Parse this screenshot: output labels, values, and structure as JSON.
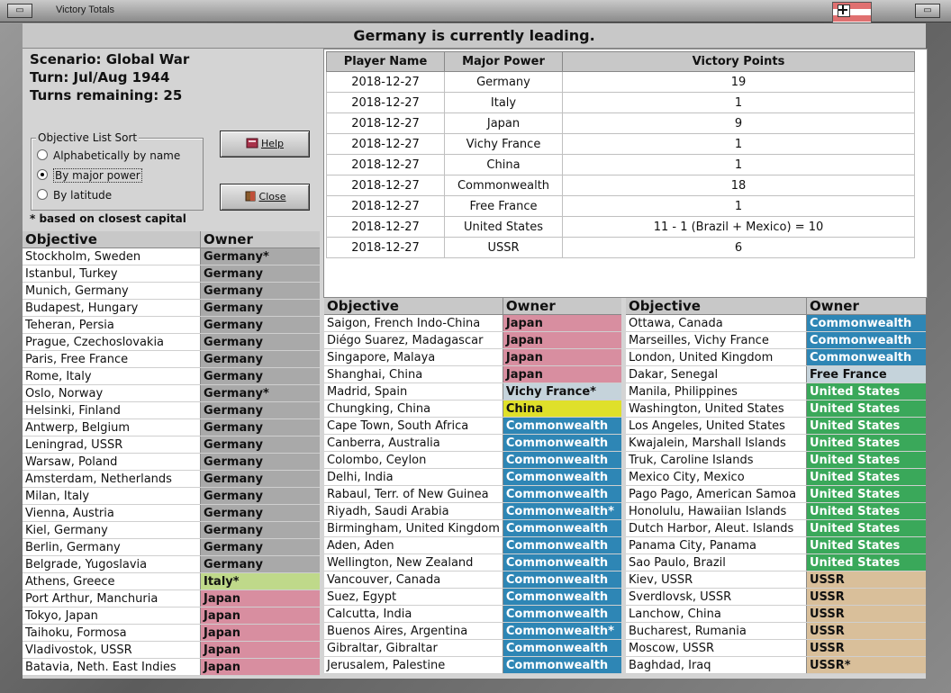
{
  "window": {
    "title": "Victory Totals",
    "menu_glyph": "▭",
    "close_glyph": "▭"
  },
  "banner": "Germany is currently leading.",
  "info": {
    "scenario": "Scenario: Global War",
    "turn": "Turn: Jul/Aug 1944",
    "turns_remaining": "Turns remaining: 25"
  },
  "sort": {
    "legend": "Objective List Sort",
    "options": [
      "Alphabetically by name",
      "By major power",
      "By latitude"
    ],
    "selected_index": 1
  },
  "note": "* based on closest capital",
  "buttons": {
    "help": "Help",
    "close": "Close"
  },
  "colors": {
    "germany": "#a9a9a9",
    "italy": "#bfd98a",
    "japan": "#d88ea0",
    "vichy": "#c5d3db",
    "china": "#dfe02a",
    "commonwealth": "#2e86b5",
    "free_france": "#c5d3db",
    "united_states": "#3aa85a",
    "ussr": "#d9bf9a"
  },
  "victory_table": {
    "headers": [
      "Player Name",
      "Major Power",
      "Victory Points"
    ],
    "rows": [
      [
        "2018-12-27",
        "Germany",
        "19"
      ],
      [
        "2018-12-27",
        "Italy",
        "1"
      ],
      [
        "2018-12-27",
        "Japan",
        "9"
      ],
      [
        "2018-12-27",
        "Vichy France",
        "1"
      ],
      [
        "2018-12-27",
        "China",
        "1"
      ],
      [
        "2018-12-27",
        "Commonwealth",
        "18"
      ],
      [
        "2018-12-27",
        "Free France",
        "1"
      ],
      [
        "2018-12-27",
        "United States",
        "11 - 1 (Brazil + Mexico) = 10"
      ],
      [
        "2018-12-27",
        "USSR",
        "6"
      ]
    ]
  },
  "objectives": {
    "headers": [
      "Objective",
      "Owner"
    ],
    "left": [
      [
        "Stockholm, Sweden",
        "Germany*",
        "germany"
      ],
      [
        "Istanbul, Turkey",
        "Germany",
        "germany"
      ],
      [
        "Munich, Germany",
        "Germany",
        "germany"
      ],
      [
        "Budapest, Hungary",
        "Germany",
        "germany"
      ],
      [
        "Teheran, Persia",
        "Germany",
        "germany"
      ],
      [
        "Prague, Czechoslovakia",
        "Germany",
        "germany"
      ],
      [
        "Paris, Free France",
        "Germany",
        "germany"
      ],
      [
        "Rome, Italy",
        "Germany",
        "germany"
      ],
      [
        "Oslo, Norway",
        "Germany*",
        "germany"
      ],
      [
        "Helsinki, Finland",
        "Germany",
        "germany"
      ],
      [
        "Antwerp, Belgium",
        "Germany",
        "germany"
      ],
      [
        "Leningrad, USSR",
        "Germany",
        "germany"
      ],
      [
        "Warsaw, Poland",
        "Germany",
        "germany"
      ],
      [
        "Amsterdam, Netherlands",
        "Germany",
        "germany"
      ],
      [
        "Milan, Italy",
        "Germany",
        "germany"
      ],
      [
        "Vienna, Austria",
        "Germany",
        "germany"
      ],
      [
        "Kiel, Germany",
        "Germany",
        "germany"
      ],
      [
        "Berlin, Germany",
        "Germany",
        "germany"
      ],
      [
        "Belgrade, Yugoslavia",
        "Germany",
        "germany"
      ],
      [
        "Athens, Greece",
        "Italy*",
        "italy"
      ],
      [
        "Port Arthur, Manchuria",
        "Japan",
        "japan"
      ],
      [
        "Tokyo, Japan",
        "Japan",
        "japan"
      ],
      [
        "Taihoku, Formosa",
        "Japan",
        "japan"
      ],
      [
        "Vladivostok, USSR",
        "Japan",
        "japan"
      ],
      [
        "Batavia, Neth. East Indies",
        "Japan",
        "japan"
      ]
    ],
    "middle": [
      [
        "Saigon, French Indo-China",
        "Japan",
        "japan"
      ],
      [
        "Diégo Suarez, Madagascar",
        "Japan",
        "japan"
      ],
      [
        "Singapore, Malaya",
        "Japan",
        "japan"
      ],
      [
        "Shanghai, China",
        "Japan",
        "japan"
      ],
      [
        "Madrid, Spain",
        "Vichy France*",
        "vichy"
      ],
      [
        "Chungking, China",
        "China",
        "china"
      ],
      [
        "Cape Town, South Africa",
        "Commonwealth",
        "commonwealth"
      ],
      [
        "Canberra, Australia",
        "Commonwealth",
        "commonwealth"
      ],
      [
        "Colombo, Ceylon",
        "Commonwealth",
        "commonwealth"
      ],
      [
        "Delhi, India",
        "Commonwealth",
        "commonwealth"
      ],
      [
        "Rabaul, Terr. of New Guinea",
        "Commonwealth",
        "commonwealth"
      ],
      [
        "Riyadh, Saudi Arabia",
        "Commonwealth*",
        "commonwealth"
      ],
      [
        "Birmingham, United Kingdom",
        "Commonwealth",
        "commonwealth"
      ],
      [
        "Aden, Aden",
        "Commonwealth",
        "commonwealth"
      ],
      [
        "Wellington, New Zealand",
        "Commonwealth",
        "commonwealth"
      ],
      [
        "Vancouver, Canada",
        "Commonwealth",
        "commonwealth"
      ],
      [
        "Suez, Egypt",
        "Commonwealth",
        "commonwealth"
      ],
      [
        "Calcutta, India",
        "Commonwealth",
        "commonwealth"
      ],
      [
        "Buenos Aires, Argentina",
        "Commonwealth*",
        "commonwealth"
      ],
      [
        "Gibraltar, Gibraltar",
        "Commonwealth",
        "commonwealth"
      ],
      [
        "Jerusalem, Palestine",
        "Commonwealth",
        "commonwealth"
      ]
    ],
    "right": [
      [
        "Ottawa, Canada",
        "Commonwealth",
        "commonwealth"
      ],
      [
        "Marseilles, Vichy France",
        "Commonwealth",
        "commonwealth"
      ],
      [
        "London, United Kingdom",
        "Commonwealth",
        "commonwealth"
      ],
      [
        "Dakar, Senegal",
        "Free France",
        "freefrance"
      ],
      [
        "Manila, Philippines",
        "United States",
        "us"
      ],
      [
        "Washington, United States",
        "United States",
        "us"
      ],
      [
        "Los Angeles, United States",
        "United States",
        "us"
      ],
      [
        "Kwajalein, Marshall Islands",
        "United States",
        "us"
      ],
      [
        "Truk, Caroline Islands",
        "United States",
        "us"
      ],
      [
        "Mexico City, Mexico",
        "United States",
        "us"
      ],
      [
        "Pago Pago, American Samoa",
        "United States",
        "us"
      ],
      [
        "Honolulu, Hawaiian Islands",
        "United States",
        "us"
      ],
      [
        "Dutch Harbor, Aleut. Islands",
        "United States",
        "us"
      ],
      [
        "Panama City, Panama",
        "United States",
        "us"
      ],
      [
        "Sao Paulo, Brazil",
        "United States",
        "us"
      ],
      [
        "Kiev, USSR",
        "USSR",
        "ussr"
      ],
      [
        "Sverdlovsk, USSR",
        "USSR",
        "ussr"
      ],
      [
        "Lanchow, China",
        "USSR",
        "ussr"
      ],
      [
        "Bucharest, Rumania",
        "USSR",
        "ussr"
      ],
      [
        "Moscow, USSR",
        "USSR",
        "ussr"
      ],
      [
        "Baghdad, Iraq",
        "USSR*",
        "ussr"
      ]
    ]
  }
}
